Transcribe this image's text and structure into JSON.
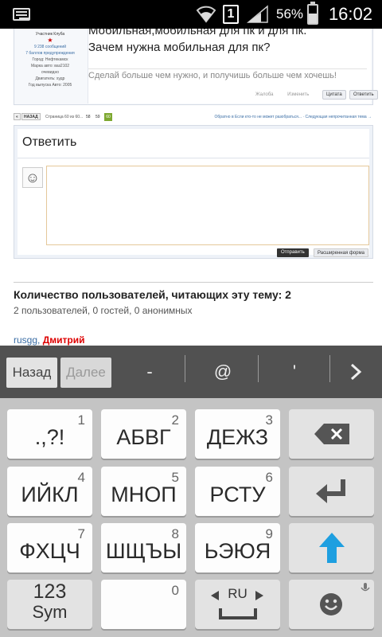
{
  "status_bar": {
    "sim_slot": "1",
    "battery": "56%",
    "time": "16:02",
    "icons": [
      "keyboard-icon",
      "wifi-icon",
      "sim-icon",
      "signal-icon",
      "battery-icon"
    ]
  },
  "post": {
    "user_role": "Участник Клуба",
    "messages": "9 238 сообщений",
    "warnings": "7 баллов предупреждения",
    "city": "Город: Нефтекамск",
    "car_brand": "Марка авто: ваз2102",
    "car_brand_2": "очевидно",
    "engine": "Двигатель: худр",
    "car_year": "Год выпуска Авто: 2005",
    "text_line1": "Мобильная,мобильная для пк и для пк.",
    "text_line2": "Зачем нужна мобильная для пк?",
    "signature": "Сделай больше чем нужно, и получишь больше чем хочешь!",
    "link_complain": "Жалоба",
    "link_edit": "Изменить",
    "quote_label": "Цитата",
    "reply_label": "Ответить"
  },
  "pager": {
    "back_arrow": "«",
    "back_label": "НАЗАД",
    "page_info": "Страница 60 из 60...",
    "pages": [
      "58",
      "59"
    ],
    "current_page": "60",
    "right_links": "Обратно в Если кто-то не может разобраться... · Следующая непрочитанная тема →"
  },
  "reply": {
    "title": "Ответить",
    "send_label": "Отправить",
    "extended_label": "Расширенная форма"
  },
  "readers": {
    "title": "Количество пользователей, читающих эту тему: 2",
    "count": "2 пользователей, 0 гостей, 0 анонимных",
    "user1": "rusgg",
    "sep": ",",
    "user2": "Дмитрий"
  },
  "suggestions": {
    "back": "Назад",
    "next": "Далее",
    "symbols": [
      "-",
      "@",
      "'"
    ]
  },
  "keyboard": {
    "keys": [
      {
        "label": ".,?!",
        "num": "1"
      },
      {
        "label": "АБВГ",
        "num": "2"
      },
      {
        "label": "ДЕЖЗ",
        "num": "3"
      },
      {
        "label": "ИЙКЛ",
        "num": "4"
      },
      {
        "label": "МНОП",
        "num": "5"
      },
      {
        "label": "РСТУ",
        "num": "6"
      },
      {
        "label": "ФХЦЧ",
        "num": "7"
      },
      {
        "label": "ШЩЪЫ",
        "num": "8"
      },
      {
        "label": "ЬЭЮЯ",
        "num": "9"
      }
    ],
    "sym_top": "123",
    "sym_bottom": "Sym",
    "space_num": "0",
    "lang": "RU",
    "accent_enter": "#1e9fe0"
  }
}
